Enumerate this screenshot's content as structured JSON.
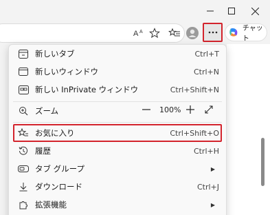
{
  "menu": {
    "items": [
      {
        "label": "新しいタブ",
        "shortcut": "Ctrl+T",
        "icon": "new-tab-icon"
      },
      {
        "label": "新しいウィンドウ",
        "shortcut": "Ctrl+N",
        "icon": "new-window-icon"
      },
      {
        "label": "新しい InPrivate ウィンドウ",
        "shortcut": "Ctrl+Shift+N",
        "icon": "inprivate-icon"
      },
      {
        "label": "お気に入り",
        "shortcut": "Ctrl+Shift+O",
        "icon": "favorites-icon"
      },
      {
        "label": "履歴",
        "shortcut": "Ctrl+H",
        "icon": "history-icon"
      },
      {
        "label": "タブ グループ",
        "shortcut": "",
        "icon": "tab-groups-icon"
      },
      {
        "label": "ダウンロード",
        "shortcut": "Ctrl+J",
        "icon": "download-icon"
      },
      {
        "label": "拡張機能",
        "shortcut": "",
        "icon": "extensions-icon"
      }
    ],
    "zoom": {
      "label": "ズーム",
      "value": "100%",
      "minus": "—",
      "plus": "+"
    }
  },
  "toolbar": {
    "chat_label": "チャット"
  },
  "colors": {
    "highlight": "#d3232c",
    "copilot_purple": "#7b4ef2",
    "copilot_blue": "#2f8bf5",
    "copilot_orange": "#f2893a"
  }
}
